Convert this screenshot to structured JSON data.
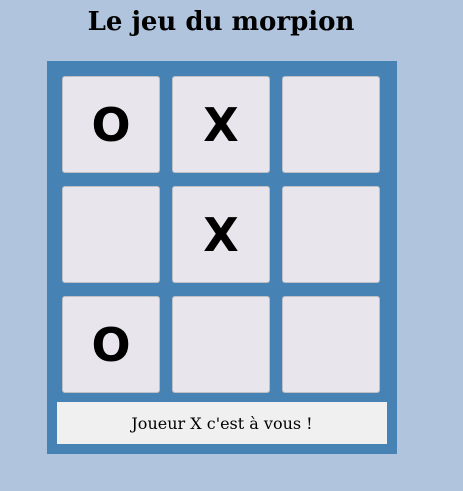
{
  "title": "Le jeu du morpion",
  "board": {
    "cells": [
      {
        "mark": "O"
      },
      {
        "mark": "X"
      },
      {
        "mark": ""
      },
      {
        "mark": ""
      },
      {
        "mark": "X"
      },
      {
        "mark": ""
      },
      {
        "mark": "O"
      },
      {
        "mark": ""
      },
      {
        "mark": ""
      }
    ]
  },
  "status": "Joueur X c'est à vous !",
  "colors": {
    "page_background": "#b0c4de",
    "board_background": "#4682b4",
    "cell_background": "#e8e6ec",
    "status_background": "#f0f0f0"
  }
}
